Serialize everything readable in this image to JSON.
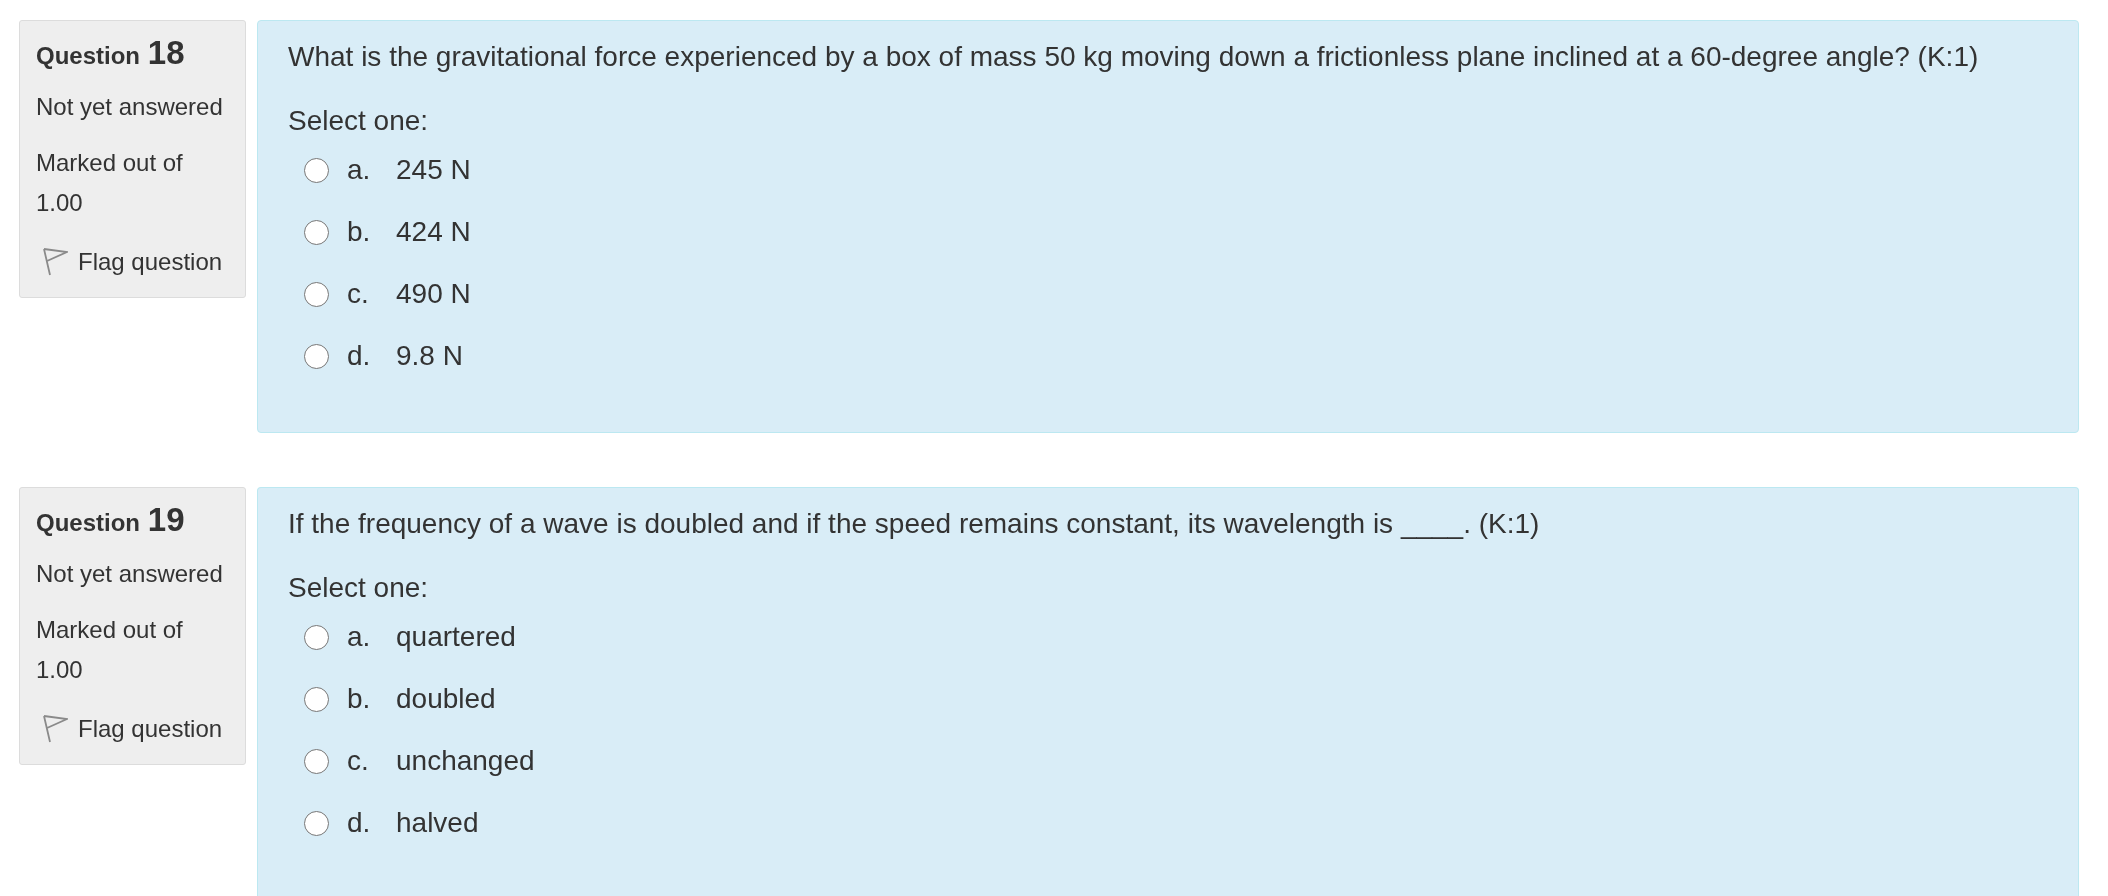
{
  "questions": [
    {
      "label": "Question",
      "number": "18",
      "status": "Not yet answered",
      "grade": "Marked out of 1.00",
      "flag": {
        "label": "Flag question",
        "flagged": false
      },
      "text": "What is the gravitational force experienced by a box of mass 50 kg moving down a frictionless plane inclined at a 60-degree angle? (K:1)",
      "prompt": "Select one:",
      "options": [
        {
          "letter": "a.",
          "text": "245 N",
          "selected": false
        },
        {
          "letter": "b.",
          "text": "424 N",
          "selected": false
        },
        {
          "letter": "c.",
          "text": "490 N",
          "selected": false
        },
        {
          "letter": "d.",
          "text": "9.8 N",
          "selected": false
        }
      ]
    },
    {
      "label": "Question",
      "number": "19",
      "status": "Not yet answered",
      "grade": "Marked out of 1.00",
      "flag": {
        "label": "Flag question",
        "flagged": false
      },
      "text": "If the frequency of a wave is doubled and if the speed remains constant, its wavelength is ____. (K:1)",
      "prompt": "Select one:",
      "options": [
        {
          "letter": "a.",
          "text": "quartered",
          "selected": false
        },
        {
          "letter": "b.",
          "text": "doubled",
          "selected": false
        },
        {
          "letter": "c.",
          "text": "unchanged",
          "selected": false
        },
        {
          "letter": "d.",
          "text": "halved",
          "selected": false
        }
      ]
    }
  ]
}
